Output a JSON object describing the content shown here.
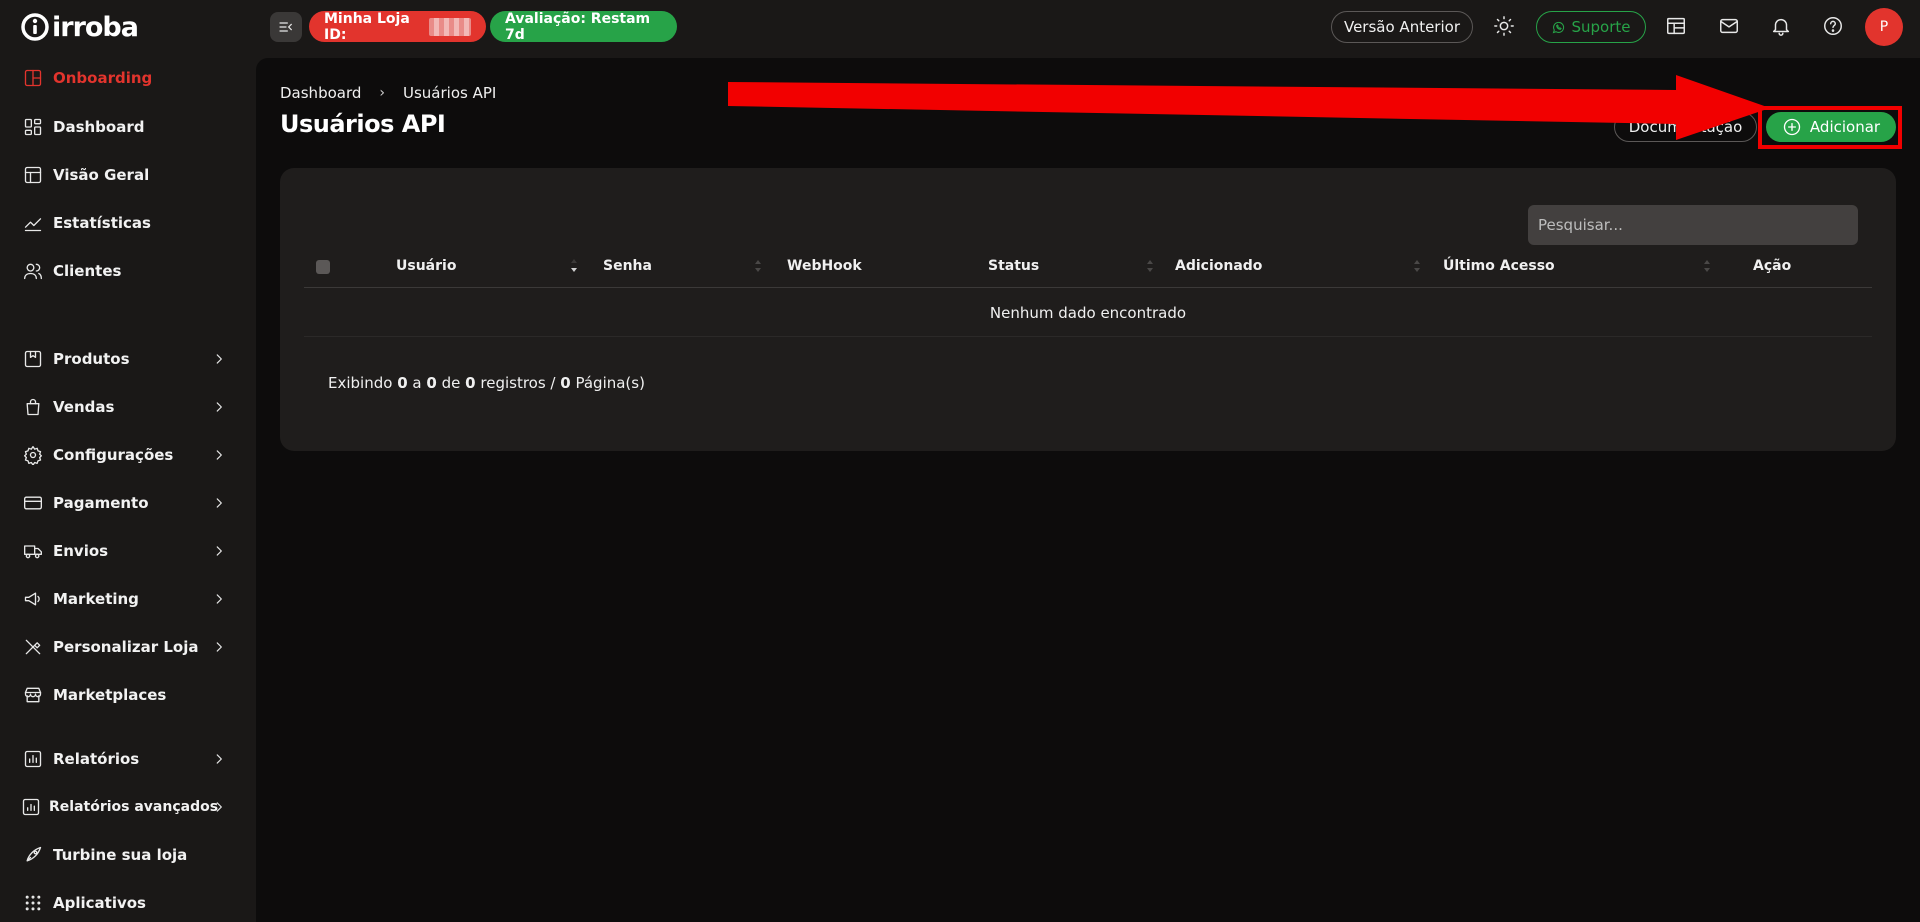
{
  "brand": {
    "logo_text": "irroba"
  },
  "sidebar": {
    "items": [
      {
        "label": "Onboarding",
        "icon": "layout-panel-icon",
        "active": true
      },
      {
        "label": "Dashboard",
        "icon": "dashboard-grid-icon"
      },
      {
        "label": "Visão Geral",
        "icon": "layout-icon"
      },
      {
        "label": "Estatísticas",
        "icon": "chart-line-icon"
      },
      {
        "label": "Clientes",
        "icon": "users-icon"
      },
      {
        "label": "Produtos",
        "icon": "box-icon",
        "expandable": true
      },
      {
        "label": "Vendas",
        "icon": "shopping-bag-icon",
        "expandable": true
      },
      {
        "label": "Configurações",
        "icon": "gear-icon",
        "expandable": true
      },
      {
        "label": "Pagamento",
        "icon": "credit-card-icon",
        "expandable": true
      },
      {
        "label": "Envios",
        "icon": "truck-icon",
        "expandable": true
      },
      {
        "label": "Marketing",
        "icon": "megaphone-icon",
        "expandable": true
      },
      {
        "label": "Personalizar Loja",
        "icon": "tools-icon",
        "expandable": true
      },
      {
        "label": "Marketplaces",
        "icon": "store-icon"
      },
      {
        "label": "Relatórios",
        "icon": "report-icon",
        "expandable": true
      },
      {
        "label": "Relatórios avançados",
        "icon": "report-advanced-icon",
        "expandable": true
      },
      {
        "label": "Turbine sua loja",
        "icon": "rocket-icon"
      },
      {
        "label": "Aplicativos",
        "icon": "apps-grid-icon"
      }
    ]
  },
  "topbar": {
    "store_label": "Minha Loja ID:",
    "evaluation_label": "Avaliação: Restam 7d",
    "previous_version_label": "Versão Anterior",
    "support_label": "Suporte",
    "avatar_initial": "P"
  },
  "main": {
    "breadcrumb": [
      "Dashboard",
      "Usuários API"
    ],
    "title": "Usuários API",
    "doc_button_label": "Documentação",
    "add_button_label": "Adicionar",
    "search_placeholder": "Pesquisar...",
    "table": {
      "columns": [
        "Usuário",
        "Senha",
        "WebHook",
        "Status",
        "Adicionado",
        "Último Acesso",
        "Ação"
      ],
      "empty_message": "Nenhum dado encontrado"
    },
    "pagination": {
      "prefix": "Exibindo",
      "from": "0",
      "to_word": "a",
      "to": "0",
      "of_word": "de",
      "total": "0",
      "records_word": "registros /",
      "pages": "0",
      "pages_word": "Página(s)"
    }
  },
  "colors": {
    "brand_red": "#e2342d",
    "success_green": "#27a348",
    "annotation_red": "#f20000"
  }
}
